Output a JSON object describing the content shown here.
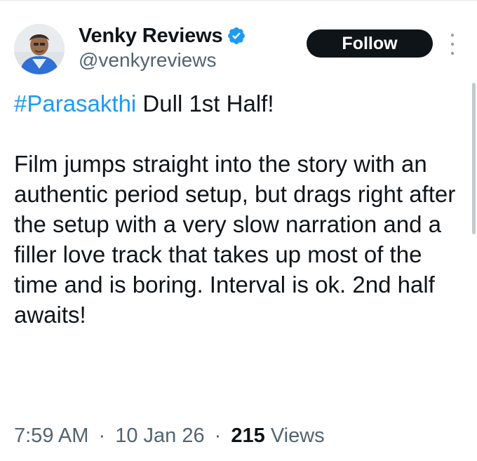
{
  "user": {
    "display_name": "Venky Reviews",
    "handle": "@venkyreviews",
    "verified": true,
    "verified_color": "#1d9bf0"
  },
  "actions": {
    "follow_label": "Follow"
  },
  "tweet": {
    "hashtag": "#Parasakthi",
    "headline_rest": " Dull 1st Half!",
    "body": "Film jumps straight into the story with an authentic period setup, but drags right after the setup with a very slow narration and a filler love track that takes up most of the time and is boring. Interval is ok. 2nd half awaits!"
  },
  "meta": {
    "time": "7:59 AM",
    "date": "10 Jan 26",
    "separator": "·",
    "views_count": "215",
    "views_label": "Views"
  },
  "colors": {
    "text": "#0f1419",
    "muted": "#536471",
    "accent": "#1d9bf0",
    "button_bg": "#0f1419"
  },
  "icons": {
    "verified": "verified-badge-icon",
    "more": "more-vertical-icon"
  }
}
